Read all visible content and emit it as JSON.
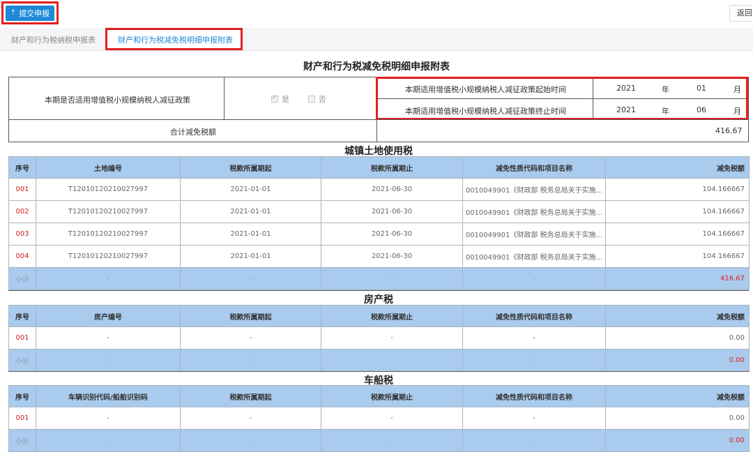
{
  "toolbar": {
    "submit_label": "提交申报",
    "submit_icon": "upload-icon",
    "back_label": "返回"
  },
  "tabs": [
    {
      "label": "财产和行为税纳税申报表",
      "active": false
    },
    {
      "label": "财产和行为税减免税明细申报附表",
      "active": true
    }
  ],
  "form": {
    "title": "财产和行为税减免税明细申报附表",
    "policy_question": "本期是否适用增值税小规模纳税人减征政策",
    "option_yes": "是",
    "option_no": "否",
    "yes_checked": true,
    "start_label": "本期适用增值税小规模纳税人减征政策起始时间",
    "end_label": "本期适用增值税小规模纳税人减征政策终止时间",
    "start_year": "2021",
    "start_month": "01",
    "end_year": "2021",
    "end_month": "06",
    "year_unit": "年",
    "month_unit": "月",
    "total_label": "合计减免税额",
    "total_value": "416.67"
  },
  "land_tax": {
    "title": "城镇土地使用税",
    "headers": [
      "序号",
      "土地编号",
      "税款所属期起",
      "税款所属期止",
      "减免性质代码和项目名称",
      "减免税额"
    ],
    "rows": [
      [
        "001",
        "T12010120210027997",
        "2021-01-01",
        "2021-06-30",
        "0010049901《财政部 税务总局关于实施...",
        "104.166667"
      ],
      [
        "002",
        "T12010120210027997",
        "2021-01-01",
        "2021-06-30",
        "0010049901《财政部 税务总局关于实施...",
        "104.166667"
      ],
      [
        "003",
        "T12010120210027997",
        "2021-01-01",
        "2021-06-30",
        "0010049901《财政部 税务总局关于实施...",
        "104.166667"
      ],
      [
        "004",
        "T12010120210027997",
        "2021-01-01",
        "2021-06-30",
        "0010049901《财政部 税务总局关于实施...",
        "104.166667"
      ]
    ],
    "subtotal": [
      "小计",
      "-",
      "-",
      "-",
      "-",
      "416.67"
    ]
  },
  "property_tax": {
    "title": "房产税",
    "headers": [
      "序号",
      "房产编号",
      "税款所属期起",
      "税款所属期止",
      "减免性质代码和项目名称",
      "减免税额"
    ],
    "rows": [
      [
        "001",
        "-",
        "-",
        "-",
        "-",
        "0.00"
      ]
    ],
    "subtotal": [
      "小计",
      "-",
      "-",
      "-",
      "-",
      "0.00"
    ]
  },
  "vehicle_tax": {
    "title": "车船税",
    "headers": [
      "序号",
      "车辆识别代码/船舶识别码",
      "税款所属期起",
      "税款所属期止",
      "减免性质代码和项目名称",
      "减免税额"
    ],
    "rows": [
      [
        "001",
        "-",
        "-",
        "-",
        "-",
        "0.00"
      ]
    ],
    "subtotal": [
      "小计",
      "-",
      "-",
      "-",
      "-",
      "0.00"
    ]
  }
}
